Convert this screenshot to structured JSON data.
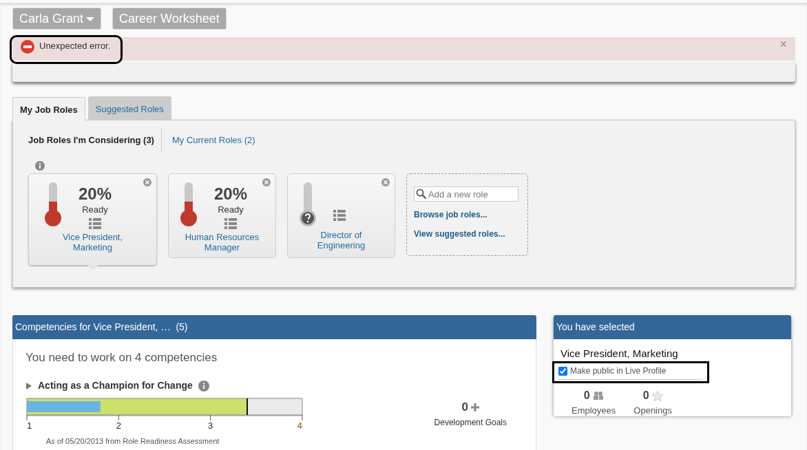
{
  "nav_buttons": [
    {
      "label": "Carla Grant",
      "kind": "dropdown"
    },
    {
      "label": "Career Worksheet",
      "kind": "plain"
    }
  ],
  "alert": {
    "message": "Unexpected error.",
    "close": "×",
    "highlighted": true
  },
  "tabs": [
    {
      "label": "My Job Roles",
      "selected": true
    },
    {
      "label": "Suggested Roles",
      "selected": false
    }
  ],
  "subtabs": [
    {
      "label": "Job Roles I'm Considering (3)",
      "selected": true
    },
    {
      "label": "My Current Roles (2)",
      "selected": false
    }
  ],
  "roles": [
    {
      "percent": "20%",
      "status": "Ready",
      "name": "Vice President, Marketing",
      "level": 0.4,
      "assessed": true,
      "selected": true
    },
    {
      "percent": "20%",
      "status": "Ready",
      "name": "Human Resources Manager",
      "level": 0.4,
      "assessed": true,
      "selected": false
    },
    {
      "name": "Director of Engineering",
      "level": 0,
      "assessed": false,
      "selected": false
    }
  ],
  "add_role": {
    "placeholder": "Add a new role",
    "links": [
      "Browse job roles...",
      "View suggested roles..."
    ]
  },
  "competencies": {
    "title": "Competencies for Vice President, …",
    "count": "(5)",
    "summary": "You need to work on 4 competencies",
    "items": [
      {
        "name": "Acting as a Champion for Change",
        "expanded": false,
        "goals_count": "0",
        "goals_label": "Development Goals",
        "source": "As of 05/20/2013 from Role Readiness Assessment",
        "chart_data": {
          "type": "bar",
          "orientation": "horizontal",
          "stacked": false,
          "xlim": [
            1,
            4
          ],
          "xticks": [
            1,
            2,
            3,
            4
          ],
          "series": [
            {
              "color": "#6ab4e0",
              "values": [
                1.8
              ]
            },
            {
              "color": "#cde06a",
              "values": [
                3.4
              ]
            }
          ]
        }
      }
    ]
  },
  "selected_panel": {
    "title": "You have selected",
    "role": "Vice President, Marketing",
    "public": {
      "label": "Make public in Live Profile",
      "checked": true,
      "highlighted": true
    },
    "stats": [
      {
        "value": "0",
        "label": "Employees",
        "kind": "people"
      },
      {
        "value": "0",
        "label": "Openings",
        "kind": "star"
      }
    ]
  }
}
